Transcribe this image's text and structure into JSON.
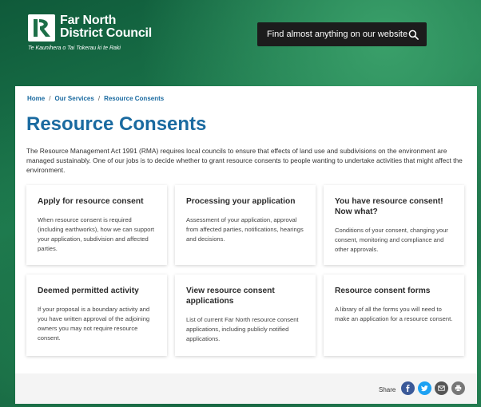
{
  "header": {
    "logo_line1": "Far North",
    "logo_line2": "District Council",
    "logo_tagline": "Te Kaunihera o Tai Tokerau ki te Raki",
    "search_placeholder": "Find almost anything on our website"
  },
  "breadcrumb": {
    "items": [
      "Home",
      "Our Services",
      "Resource Consents"
    ],
    "separator": "/"
  },
  "page": {
    "title": "Resource Consents",
    "intro": "The Resource Management Act 1991 (RMA) requires local councils to ensure that effects of land use and subdivisions on the environment are managed sustainably. One of our jobs is to decide whether to grant resource consents to people wanting to undertake activities that might affect the environment."
  },
  "cards": [
    {
      "title": "Apply for resource consent",
      "desc": "When resource consent is required (including earthworks), how we can support your application, subdivision and affected parties."
    },
    {
      "title": "Processing your application",
      "desc": "Assessment of your application, approval from affected parties, notifications, hearings and decisions."
    },
    {
      "title": "You have resource consent! Now what?",
      "desc": "Conditions of your consent, changing your consent, monitoring and compliance and other approvals."
    },
    {
      "title": "Deemed permitted activity",
      "desc": "If your proposal is a boundary activity and you have written approval of the adjoining owners you may not require resource consent."
    },
    {
      "title": "View resource consent applications",
      "desc": "List of current Far North resource consent applications, including publicly notified applications."
    },
    {
      "title": "Resource consent forms",
      "desc": "A library of all the forms you will need to make an application for a resource consent."
    }
  ],
  "share": {
    "label": "Share",
    "buttons": [
      {
        "icon": "facebook-icon",
        "color": "#3b5998"
      },
      {
        "icon": "twitter-icon",
        "color": "#1da1f2"
      },
      {
        "icon": "email-icon",
        "color": "#555555"
      },
      {
        "icon": "print-icon",
        "color": "#777777"
      }
    ]
  },
  "colors": {
    "accent": "#1a6aa0",
    "header_bg": "#1c1c1c"
  }
}
